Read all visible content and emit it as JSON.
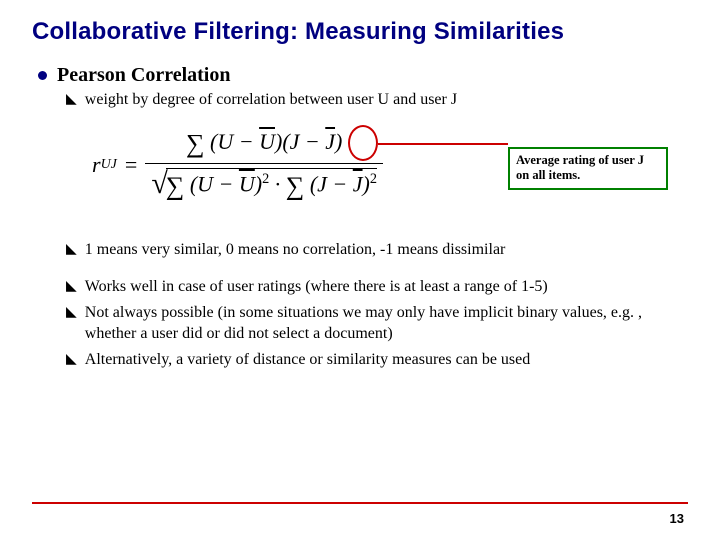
{
  "title": "Collaborative Filtering: Measuring Similarities",
  "main_bullet": "Pearson Correlation",
  "sub_bullets": [
    "weight by degree of correlation between user U and user J",
    "1 means very similar, 0 means no correlation, -1 means dissimilar",
    "Works well in case of user ratings (where there is at least a range of 1-5)",
    "Not always possible (in some situations we may only have implicit binary values, e.g. , whether a user did or did not select a document)",
    "Alternatively, a variety of distance or similarity measures can be used"
  ],
  "formula": {
    "lhs_var": "r",
    "lhs_sub": "UJ",
    "eq": "=",
    "U": "U",
    "J": "J",
    "Ubar": "U",
    "Jbar": "J",
    "sum": "∑",
    "dot": "·",
    "sq": "2",
    "minus": "−",
    "lp": "(",
    "rp": ")"
  },
  "callout": {
    "line1": "Average rating of user J",
    "line2": "on all items."
  },
  "page_number": "13"
}
